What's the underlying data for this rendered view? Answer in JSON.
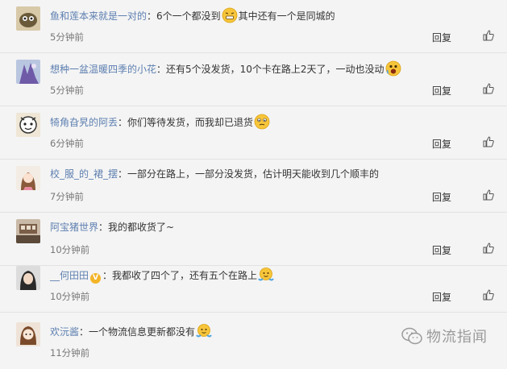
{
  "comments": [
    {
      "username": "鱼和莲本来就是一对的",
      "text_before": "：6个一个都没到",
      "emoji": "grimace-emoji",
      "text_after": "其中还有一个是同城的",
      "time": "5分钟前",
      "reply": "回复"
    },
    {
      "username": "想种一盆温暖四季的小花",
      "text_before": "：还有5个没发货，10个卡在路上2天了，一动也没动",
      "emoji": "shocked-emoji",
      "text_after": "",
      "time": "5分钟前",
      "reply": "回复"
    },
    {
      "username": "犄角旮旯的阿丢",
      "text_before": "：你们等待发货，而我却已退货",
      "emoji": "awkward-emoji",
      "text_after": "",
      "time": "6分钟前",
      "reply": "回复"
    },
    {
      "username": "校_服_的_裙_摆",
      "text_before": "：一部分在路上，一部分没发货，估计明天能收到几个顺丰的",
      "emoji": "",
      "text_after": "",
      "time": "7分钟前",
      "reply": "回复"
    },
    {
      "username": "阿宝猪世界",
      "text_before": "：我的都收货了~",
      "emoji": "",
      "text_after": "",
      "time": "10分钟前",
      "reply": "回复"
    },
    {
      "username": "__何田田",
      "verified": "V",
      "text_before": "：我都收了四个了，还有五个在路上",
      "emoji": "shrug-emoji",
      "text_after": "",
      "time": "10分钟前",
      "reply": "回复"
    },
    {
      "username": "欢沅酱",
      "text_before": "：一个物流信息更新都没有",
      "emoji": "shrug-emoji",
      "text_after": "",
      "time": "11分钟前",
      "reply": "回复"
    }
  ],
  "watermark": {
    "text": "物流指闻",
    "icon": "wechat-icon"
  },
  "colors": {
    "username": "#5d7fb0",
    "text": "#333333",
    "time": "#777777",
    "background": "#f4f4f4"
  }
}
